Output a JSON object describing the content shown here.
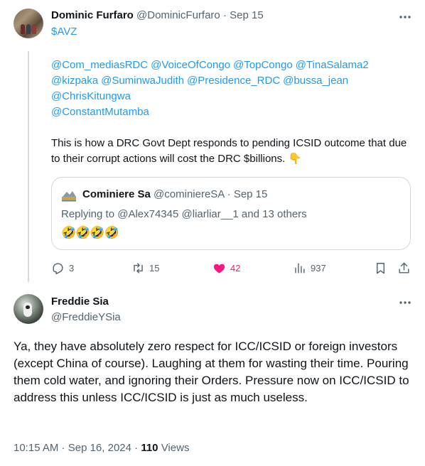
{
  "tweet1": {
    "name": "Dominic Furfaro",
    "handle": "@DominicFurfaro",
    "sep": " · ",
    "date": "Sep 15",
    "cashtag": "$AVZ",
    "mentions": [
      "@Com_mediasRDC",
      "@VoiceOfCongo",
      "@TopCongo",
      "@TinaSalama2",
      "@kizpaka",
      "@SuminwaJudith",
      "@Presidence_RDC",
      "@bussa_jean",
      "@ChrisKitungwa",
      "@ConstantMutamba"
    ],
    "text": "This is how a DRC Govt Dept responds to pending ICSID outcome that due to their corrupt actions will cost the DRC $billions. 👇",
    "quote": {
      "name": "Cominiere Sa",
      "handle": "@cominiereSA",
      "date": "Sep 15",
      "reply_prefix": "Replying to ",
      "reply_users": "@Alex74345 @liarliar__1",
      "reply_suffix": " and 13 others",
      "emojis": "🤣🤣🤣🤣"
    },
    "actions": {
      "replies": "3",
      "retweets": "15",
      "likes": "42",
      "views": "937"
    }
  },
  "tweet2": {
    "name": "Freddie Sia",
    "handle": "@FreddieYSia",
    "text": "Ya, they have absolutely zero respect for ICC/ICSID or foreign investors (except China of course). Laughing at them for wasting their time. Pouring them cold water, and ignoring their Orders. Pressure now on ICC/ICSID to address this unless ICC/ICSID is just as much useless.",
    "time": "10:15 AM",
    "date": "Sep 16, 2024",
    "views_count": "110",
    "views_label": "Views"
  },
  "icons": {
    "more": "more-icon",
    "reply": "reply-icon",
    "retweet": "retweet-icon",
    "like": "heart-icon",
    "views": "views-icon",
    "bookmark": "bookmark-icon",
    "share": "share-icon"
  },
  "colors": {
    "link": "#1d9bf0",
    "like": "#f91880",
    "muted": "#536471"
  }
}
